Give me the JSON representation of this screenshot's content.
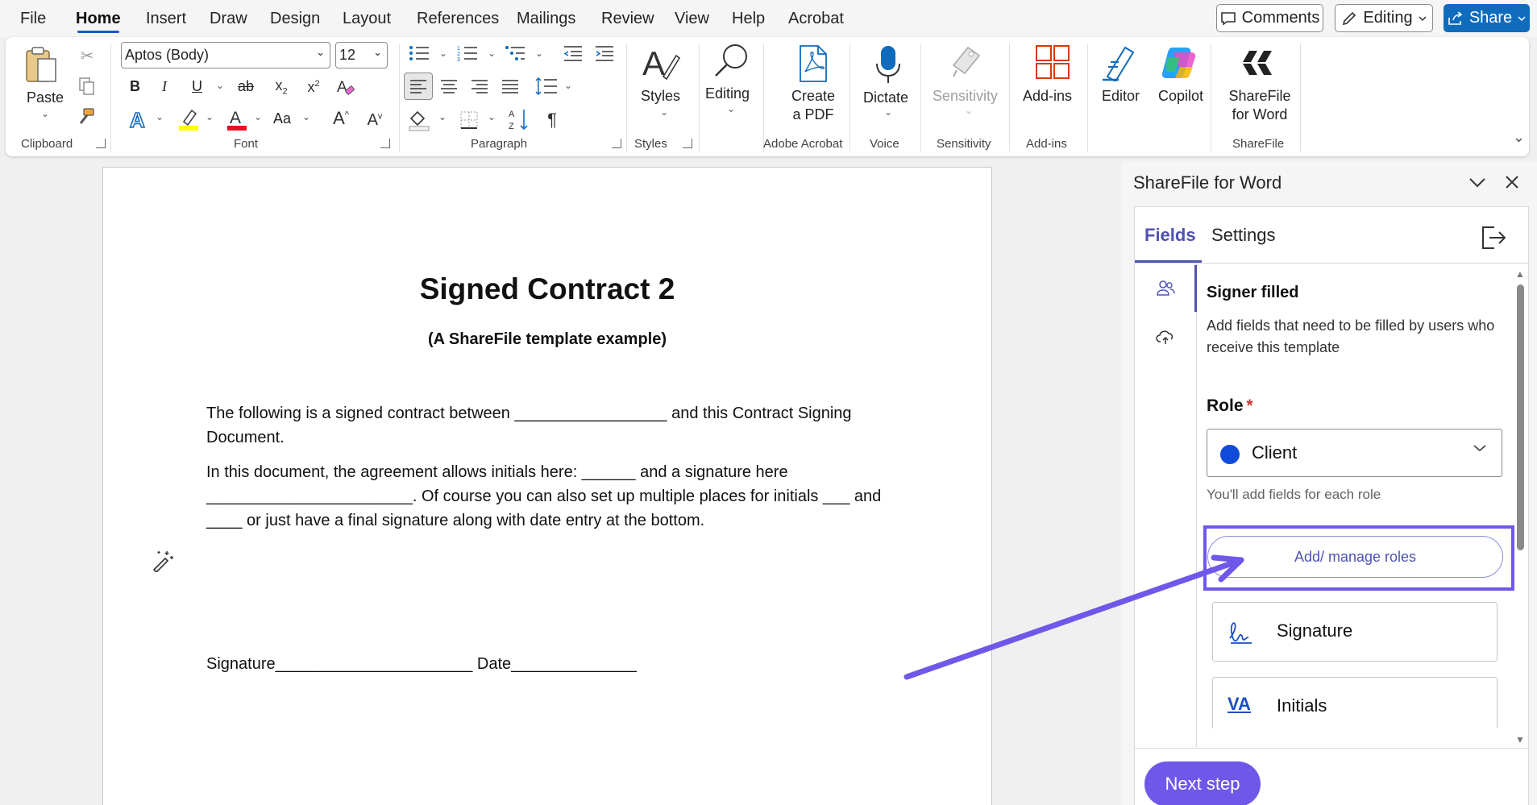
{
  "menu": {
    "items": [
      "File",
      "Home",
      "Insert",
      "Draw",
      "Design",
      "Layout",
      "References",
      "Mailings",
      "Review",
      "View",
      "Help",
      "Acrobat"
    ],
    "active": "Home",
    "comments": "Comments",
    "editing": "Editing",
    "share": "Share"
  },
  "ribbon": {
    "paste": "Paste",
    "clipboard": "Clipboard",
    "font_name": "Aptos (Body)",
    "font_size": "12",
    "font": "Font",
    "paragraph": "Paragraph",
    "styles": "Styles",
    "styles_group": "Styles",
    "editing": "Editing",
    "create_pdf_1": "Create",
    "create_pdf_2": "a PDF",
    "adobe_acrobat": "Adobe Acrobat",
    "dictate": "Dictate",
    "voice": "Voice",
    "sensitivity_btn": "Sensitivity",
    "sensitivity": "Sensitivity",
    "addins_btn": "Add-ins",
    "addins": "Add-ins",
    "editor": "Editor",
    "copilot": "Copilot",
    "sharefile_1": "ShareFile",
    "sharefile_2": "for Word",
    "sharefile_group": "ShareFile",
    "bold": "B",
    "italic": "I",
    "underline": "U",
    "strike": "ab",
    "case": "Aa"
  },
  "document": {
    "title": "Signed Contract 2",
    "subtitle": "(A ShareFile template example)",
    "para1": "The following is a signed contract between _________________ and this Contract Signing Document.",
    "para2": "In this document, the agreement allows initials here: ______ and a signature here _______________________. Of course you can also set up multiple places for initials ___ and ____ or just have a final signature along with date entry at the bottom.",
    "signature_line": "Signature______________________ Date______________"
  },
  "panel": {
    "title": "ShareFile for Word",
    "tabs": {
      "fields": "Fields",
      "settings": "Settings"
    },
    "section_title": "Signer filled",
    "section_desc": "Add fields that need to be filled by users who receive this template",
    "role_label": "Role",
    "role_required": "*",
    "role_value": "Client",
    "role_color": "#0f4bd6",
    "role_hint": "You'll add fields for each role",
    "manage_roles": "Add/ manage roles",
    "fields": [
      {
        "label": "Signature",
        "icon": "signature-icon"
      },
      {
        "label": "Initials",
        "icon": "initials-icon",
        "icon_text": "VA"
      }
    ],
    "next_step": "Next step",
    "accent": "#6f58e9"
  }
}
